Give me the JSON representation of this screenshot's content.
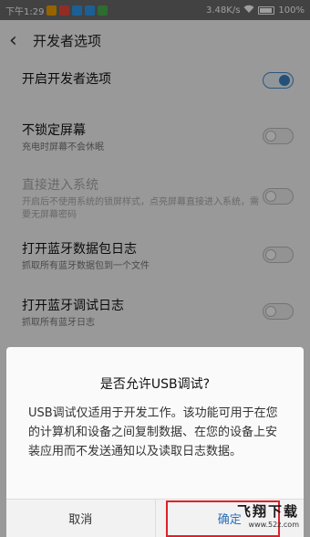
{
  "status_bar": {
    "time": "下午1:29",
    "speed": "3.48K/s",
    "battery": "100%",
    "app_colors": [
      "#f2a100",
      "#e94b3c",
      "#2d9bf0",
      "#2d9bf0",
      "#4caf50"
    ]
  },
  "header": {
    "title": "开发者选项"
  },
  "settings": [
    {
      "title": "开启开发者选项",
      "subtitle": "",
      "on": true,
      "disabled": false
    },
    {
      "title": "不锁定屏幕",
      "subtitle": "充电时屏幕不会休眠",
      "on": false,
      "disabled": false
    },
    {
      "title": "直接进入系统",
      "subtitle": "开启后不使用系统的锁屏样式，点亮屏幕直接进入系统，需要无屏幕密码",
      "on": false,
      "disabled": true
    },
    {
      "title": "打开蓝牙数据包日志",
      "subtitle": "抓取所有蓝牙数据包到一个文件",
      "on": false,
      "disabled": false
    },
    {
      "title": "打开蓝牙调试日志",
      "subtitle": "抓取所有蓝牙日志",
      "on": false,
      "disabled": false
    }
  ],
  "dialog": {
    "title": "是否允许USB调试?",
    "message": "USB调试仅适用于开发工作。该功能可用于在您的计算机和设备之间复制数据、在您的设备上安装应用而不发送通知以及读取日志数据。",
    "cancel_label": "取消",
    "ok_label": "确定"
  },
  "watermark": {
    "main": "飞翔下载",
    "sub": "www.52z.com"
  }
}
